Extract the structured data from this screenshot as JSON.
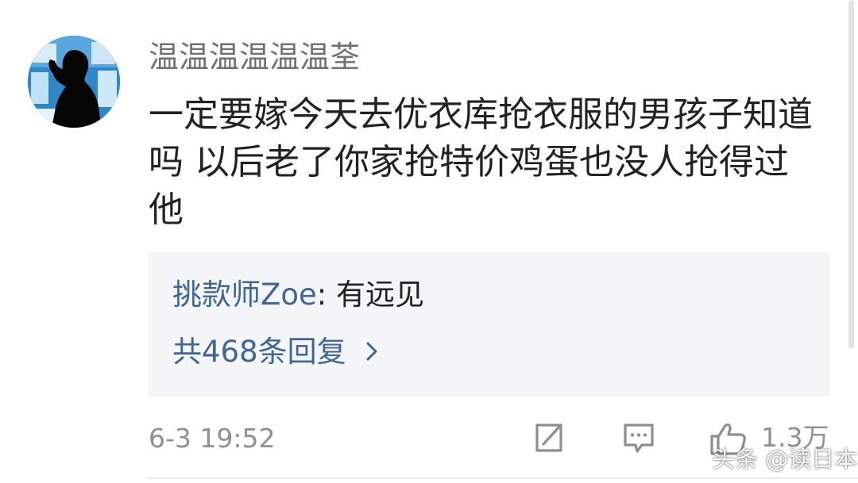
{
  "comment": {
    "username": "温温温温温温荃",
    "text": "一定要嫁今天去优衣库抢衣服的男孩子知道吗 以后老了你家抢特价鸡蛋也没人抢得过他",
    "timestamp": "6-3 19:52",
    "like_count": "1.3万"
  },
  "reply_preview": {
    "author": "挑款师Zoe",
    "separator": ":",
    "text": "有远见",
    "count_label": "共468条回复"
  },
  "icons": {
    "avatar": "silhouette-avatar",
    "chevron": "chevron-right-icon",
    "share": "share-icon",
    "comment": "comment-icon",
    "like": "thumbs-up-icon"
  },
  "colors": {
    "link": "#406599",
    "text": "#222222",
    "muted": "#909090",
    "reply_bg": "#f4f5f6"
  },
  "watermark": "头条 @读日本"
}
